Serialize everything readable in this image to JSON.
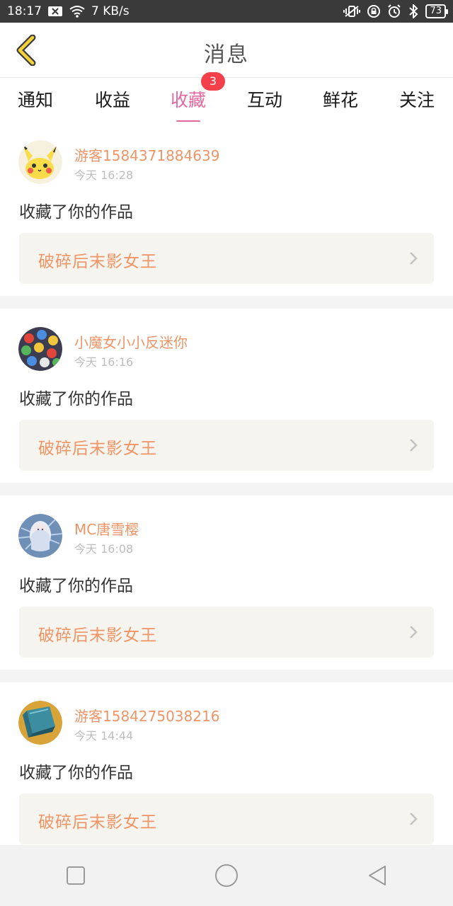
{
  "status_bar": {
    "time": "18:17",
    "speed": "7 KB/s",
    "battery": "73"
  },
  "header": {
    "title": "消息"
  },
  "tabs": [
    {
      "label": "通知"
    },
    {
      "label": "收益"
    },
    {
      "label": "收藏",
      "active": true,
      "badge": "3"
    },
    {
      "label": "互动"
    },
    {
      "label": "鲜花"
    },
    {
      "label": "关注"
    }
  ],
  "messages": [
    {
      "user": "游客1584371884639",
      "time": "今天 16:28",
      "action": "收藏了你的作品",
      "work": "破碎后末影女王",
      "avatar_icon": "pikachu-avatar"
    },
    {
      "user": "小魔女小小反迷你",
      "time": "今天 16:16",
      "action": "收藏了你的作品",
      "work": "破碎后末影女王",
      "avatar_icon": "pokeball-pattern-avatar"
    },
    {
      "user": "MC唐雪樱",
      "time": "今天 16:08",
      "action": "收藏了你的作品",
      "work": "破碎后末影女王",
      "avatar_icon": "anime-girl-avatar"
    },
    {
      "user": "游客1584275038216",
      "time": "今天 14:44",
      "action": "收藏了你的作品",
      "work": "破碎后末影女王",
      "avatar_icon": "blue-cube-avatar"
    }
  ],
  "colors": {
    "accent": "#e4679c",
    "username": "#ee9466",
    "badge": "#f4404a",
    "work_bg": "#f5f4ee"
  }
}
